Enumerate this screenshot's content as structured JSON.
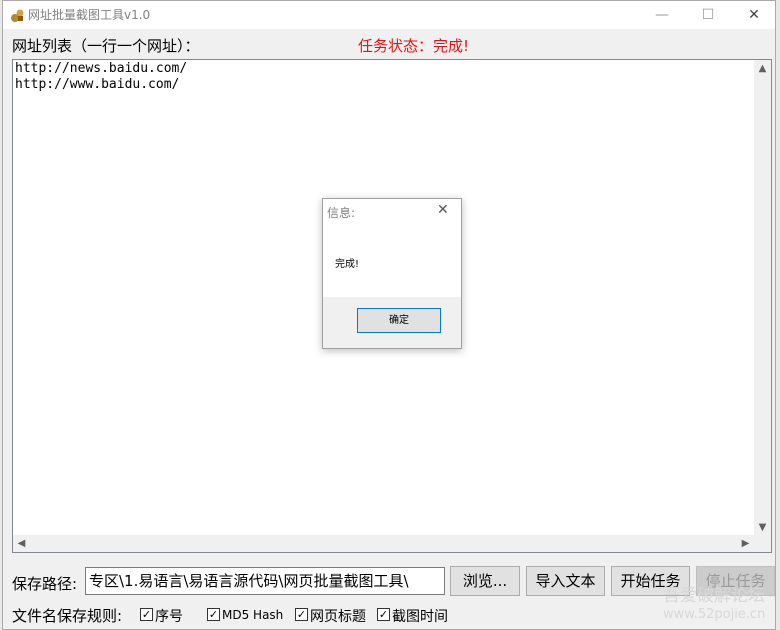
{
  "window": {
    "title": "网址批量截图工具v1.0",
    "min_glyph": "—",
    "max_glyph": "☐",
    "close_glyph": "✕"
  },
  "main": {
    "list_label": "网址列表（一行一个网址）：",
    "status_text": "任务状态：完成!",
    "urls_text": "http://news.baidu.com/\nhttp://www.baidu.com/"
  },
  "dialog": {
    "title": "信息:",
    "message": "完成!",
    "ok_label": "确定"
  },
  "bottom": {
    "save_label": "保存路径:",
    "path_value": "专区\\1.易语言\\易语言源代码\\网页批量截图工具\\",
    "browse_label": "浏览...",
    "import_label": "导入文本",
    "start_label": "开始任务",
    "stop_label": "停止任务",
    "rule_label": "文件名保存规则:",
    "options": [
      {
        "label": "序号",
        "checked": true
      },
      {
        "label": "MD5 Hash",
        "checked": true
      },
      {
        "label": "网页标题",
        "checked": true
      },
      {
        "label": "截图时间",
        "checked": true
      }
    ]
  },
  "watermark": {
    "line1": "吾爱破解论坛",
    "line2": "www.52pojie.cn"
  },
  "colors": {
    "status_red": "#e01414",
    "dialog_focus": "#0078d7"
  }
}
